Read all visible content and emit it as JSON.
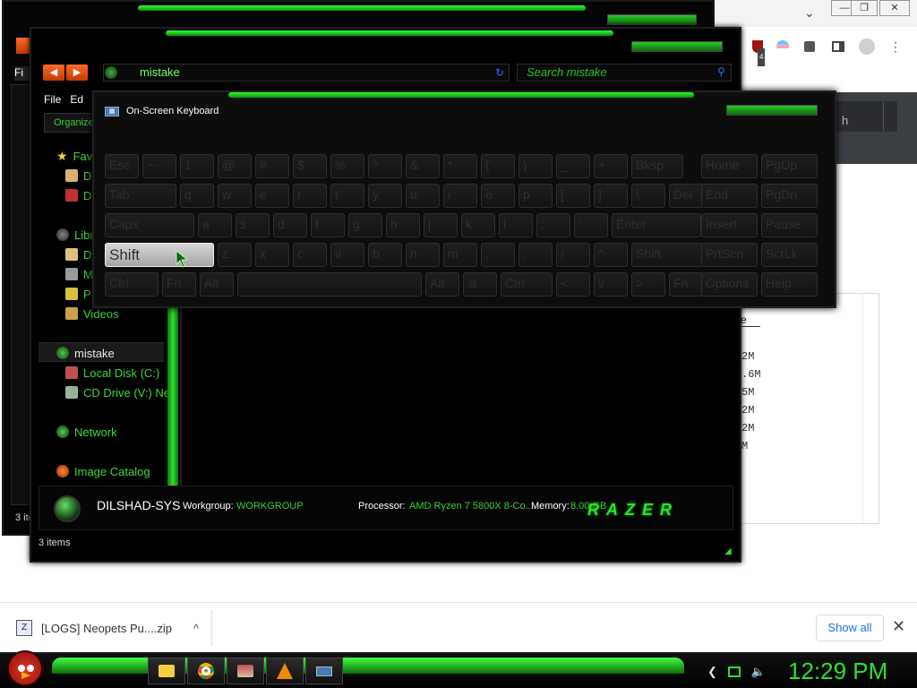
{
  "chrome": {
    "minimize": "—",
    "restore": "❐",
    "close": "✕",
    "dropdown": "⌄",
    "ext_badge": "4",
    "search_partial": "h",
    "sort_partial": "e",
    "sizes": [
      "2M",
      ".6M",
      "5M",
      "2M",
      "2M",
      "M"
    ],
    "menu_dots": "⋮",
    "accent": "#1a73e8"
  },
  "downloads": {
    "file": "[LOGS] Neopets Pu....zip",
    "chevron": "^",
    "show_all": "Show all",
    "close": "✕"
  },
  "explorer": {
    "back_menu": "Fi",
    "address": "mistake",
    "search_placeholder": "Search mistake",
    "menu": {
      "file": "File",
      "edit": "Ed"
    },
    "organize": "Organize",
    "nav": {
      "favorites": "Fav",
      "fav1": "D",
      "fav2": "D",
      "libraries": "Libr",
      "lib1": "D",
      "lib2": "M",
      "lib3": "P",
      "videos": "Videos",
      "folder": "mistake",
      "local_disk": "Local Disk (C:)",
      "cd_drive": "CD Drive (V:) Ne",
      "network": "Network",
      "image_catalog": "Image Catalog"
    },
    "details": {
      "host": "DILSHAD-SYS",
      "workgroup_label": "Workgroup:",
      "workgroup": "WORKGROUP",
      "processor_label": "Processor:",
      "processor": "AMD Ryzen 7 5800X 8-Co...",
      "memory_label": "Memory:",
      "memory": "8.00 GB",
      "logo": "RAZER"
    },
    "status": "3 items",
    "back_status": "3 ite",
    "accent": "#2ee02e"
  },
  "osk": {
    "title": "On-Screen Keyboard",
    "rows": [
      [
        "Esc",
        "~",
        "1",
        "@",
        "#",
        "$",
        "%",
        "^",
        "&",
        "*",
        "(",
        ")",
        "_",
        "+",
        "Bksp",
        "Home",
        "PgUp"
      ],
      [
        "Tab",
        "q",
        "w",
        "e",
        "r",
        "t",
        "y",
        "u",
        "i",
        "o",
        "p",
        "[",
        "]",
        "\\",
        "Del",
        "End",
        "PgDn"
      ],
      [
        "Caps",
        "a",
        "s",
        "d",
        "f",
        "g",
        "h",
        "j",
        "k",
        "l",
        ";",
        "'",
        "Enter",
        "Insert",
        "Pause"
      ],
      [
        "Shift",
        "z",
        "x",
        "c",
        "v",
        "b",
        "n",
        "m",
        ",",
        ".",
        "/",
        "^",
        "Shift",
        "PrtScn",
        "ScrLk"
      ],
      [
        "Ctrl",
        "Fn",
        "Alt",
        "",
        "Alt",
        "≣",
        "Ctrl",
        "<",
        "v",
        ">",
        "Fn",
        "Options",
        "Help"
      ]
    ],
    "active_key": "Shift"
  },
  "taskbar": {
    "clock": "12:29 PM"
  }
}
